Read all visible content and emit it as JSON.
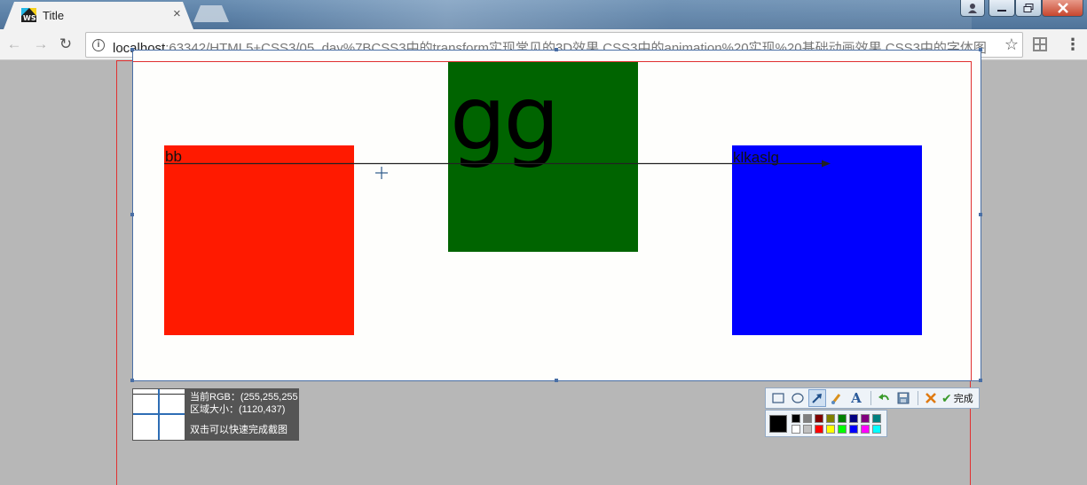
{
  "browser": {
    "tab_title": "Title",
    "tab_close": "×",
    "url_host": "localhost",
    "url_rest": ":63342/HTML5+CSS3/05_day%7BCSS3中的transform实现常见的3D效果,CSS3中的animation%20实现%20基础动画效果,CSS3中的字体图"
  },
  "page": {
    "red_box_label": "bb",
    "green_box_text": "gg",
    "blue_box_label": "klkaslg"
  },
  "capture": {
    "rgb_line": "当前RGB：(255,255,255",
    "size_line": "区域大小：(1120,437)",
    "hint_line": "双击可以快速完成截图",
    "done_label": "完成"
  },
  "colors": {
    "red_box": "#ff1a00",
    "green_box": "#006400",
    "blue_box": "#0000ff",
    "selection_border": "#4a6fa5"
  },
  "palette": {
    "current": "#000000",
    "top_row": [
      "#000000",
      "#808080",
      "#800000",
      "#808000",
      "#008000",
      "#000080",
      "#800080",
      "#008080"
    ],
    "bottom_row": [
      "#ffffff",
      "#c0c0c0",
      "#ff0000",
      "#ffff00",
      "#00ff00",
      "#0000ff",
      "#ff00ff",
      "#00ffff"
    ]
  },
  "icons": {
    "favicon": "webstorm-icon",
    "tools": [
      "rectangle-tool-icon",
      "ellipse-tool-icon",
      "arrow-tool-icon",
      "brush-tool-icon",
      "text-tool-icon",
      "undo-icon",
      "save-icon",
      "cancel-icon",
      "done-check-icon"
    ]
  }
}
